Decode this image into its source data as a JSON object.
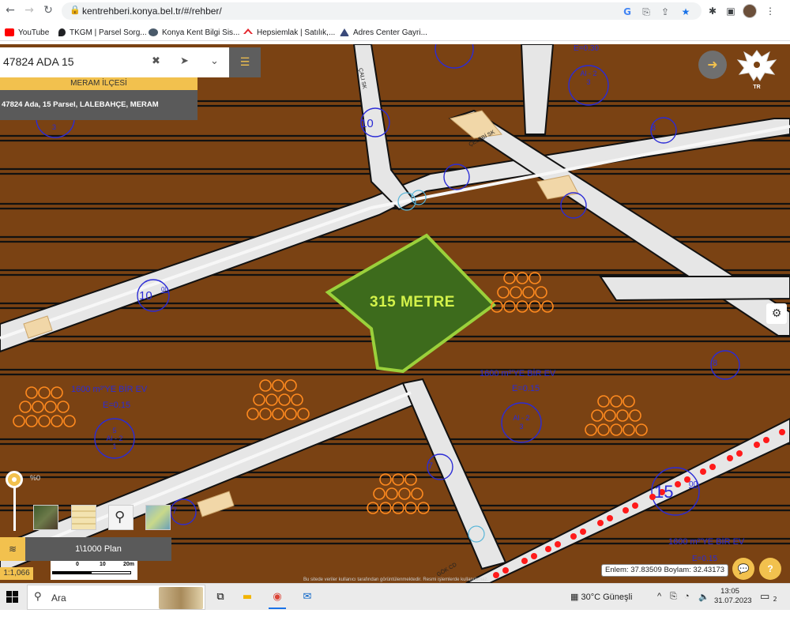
{
  "browser": {
    "url": "kentrehberi.konya.bel.tr/#/rehber/",
    "bookmarks": [
      {
        "label": "YouTube",
        "color": "#ff0000"
      },
      {
        "label": "TKGM | Parsel Sorg...",
        "color": "#202124"
      },
      {
        "label": "Konya Kent Bilgi Sis...",
        "color": "#4a5a6a"
      },
      {
        "label": "Hepsiemlak | Satılık,...",
        "color": "#e4262c"
      },
      {
        "label": "Adres Center Gayri...",
        "color": "#3a4a7a"
      }
    ]
  },
  "search": {
    "value": "47824 ADA 15",
    "clear_icon": "close-icon",
    "locate_icon": "location-arrow-icon",
    "dropdown_icon": "chevron-down-icon",
    "menu_icon": "list-icon"
  },
  "parcel": {
    "district": "MERAM İLÇESİ",
    "info": "47824 Ada, 15 Parsel, LALEBAHÇE, MERAM",
    "highlight_label": "315 METRE"
  },
  "map": {
    "labels": {
      "zoning_a": "1600 m²'YE BİR EV",
      "zoning_a_e": "E=0.15",
      "zoning_b": "1600 m²'YE BİR EV",
      "zoning_b_e": "E=0.15",
      "zoning_c": "1600 m²'YE BİR EV",
      "zoning_c_e": "E=0.15",
      "e_top": "E=0.30",
      "street_1": "ÇALI SK",
      "street_2": "ÇELEBİ SK",
      "street_3": "GÖK CD",
      "circle_al": "Al",
      "circle_minus2": "- 2",
      "circle_3": "3",
      "circle_5": "5",
      "circle_1": "1",
      "road_num_10a": "10",
      "road_num_10b": "10",
      "road_num_15": "15",
      "road_sup_00": "00",
      "road_num_8": "8",
      "road_num_7": "7"
    },
    "slider_percent": "%0",
    "plan_label": "1\\1000 Plan",
    "scale_ratio": "1:1,066",
    "scale_ticks": [
      "0",
      "10",
      "20m"
    ],
    "coordinates": "Enlem: 37.83509 Boylam: 32.43173",
    "disclaimer": "Bu sitede veriler kullanıcı tarafından görüntülenmektedir. Resmi işlemlerde kullanılamaz.",
    "colors": {
      "parcel_ground": "#7a4213",
      "road": "#e6e6e6",
      "highlight_fill": "#3d6b1c",
      "highlight_stroke": "#9bd13b",
      "highlight_text": "#d4f24a",
      "accent": "#f2c14e",
      "tree_orange": "#ff8a1f",
      "zoning_blue": "#2b2bd6",
      "rail_red": "#ff1a1a"
    }
  },
  "taskbar": {
    "search_placeholder": "Ara",
    "weather": "30°C Güneşli",
    "time": "13:05",
    "date": "31.07.2023",
    "notifications": "2"
  }
}
